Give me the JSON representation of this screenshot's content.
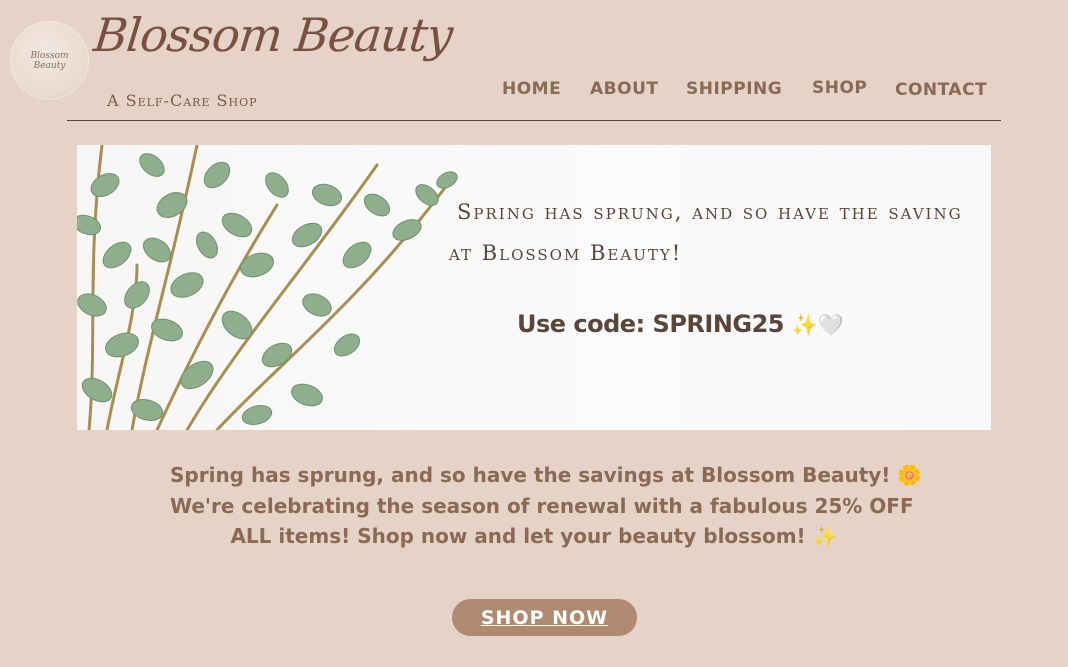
{
  "header": {
    "logo_text_top": "Blossom",
    "logo_text_bottom": "Beauty",
    "brand": "Blossom Beauty",
    "tagline": "A Self-Care Shop"
  },
  "nav": {
    "items": [
      {
        "label": "HOME"
      },
      {
        "label": "ABOUT"
      },
      {
        "label": "SHIPPING"
      },
      {
        "label": "SHOP"
      },
      {
        "label": "CONTACT"
      }
    ]
  },
  "banner": {
    "line1": "Spring has sprung, and so have the saving",
    "line2": "at Blossom Beauty!",
    "code_text": "Use code: SPRING25",
    "code_emojis": "✨🤍",
    "image_icon": "eucalyptus-leaves-icon"
  },
  "promo": {
    "line1": "Spring has sprung, and so have the savings at Blossom Beauty! 🌼",
    "line2": "We're celebrating the season of renewal with a fabulous 25% OFF",
    "line3": "ALL items! Shop now and let your beauty blossom! ✨"
  },
  "cta": {
    "label": "SHOP NOW"
  },
  "colors": {
    "background": "#e5d3c8",
    "text": "#8a6a55",
    "button": "#b08a70",
    "banner_bg": "#f8f8f8"
  }
}
